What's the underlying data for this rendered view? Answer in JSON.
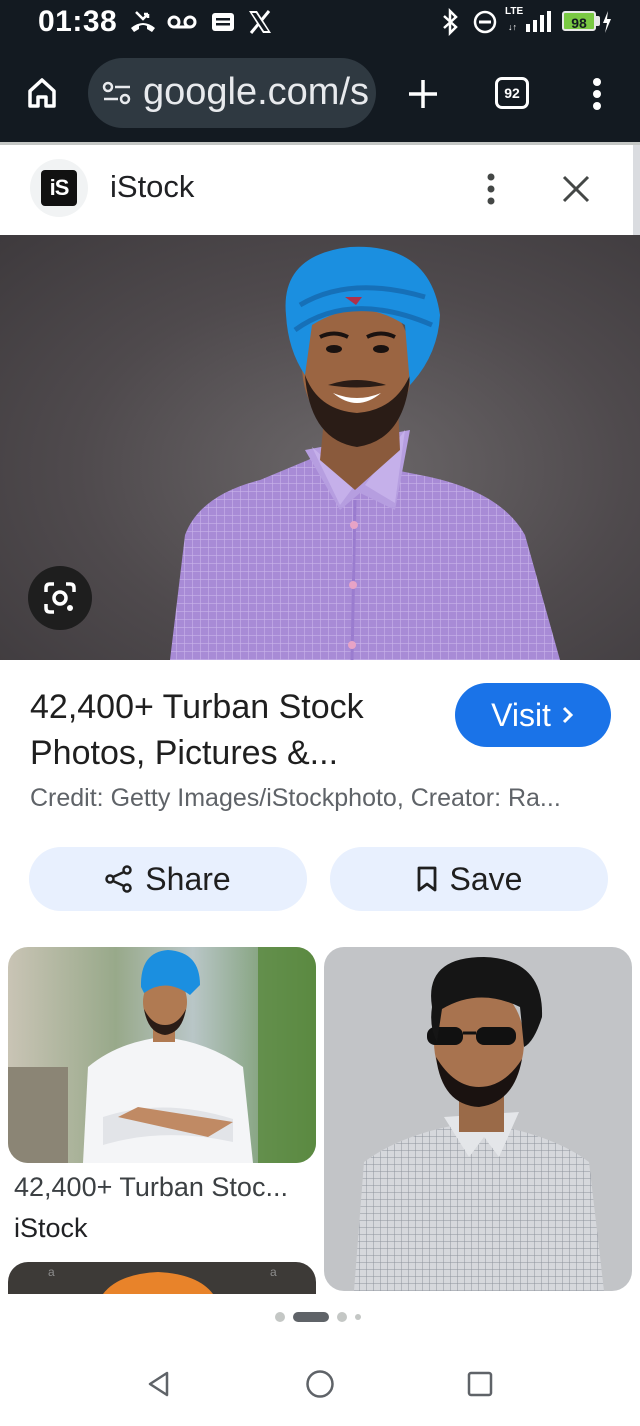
{
  "status_bar": {
    "time": "01:38",
    "network": "LTE",
    "battery": "98"
  },
  "browser": {
    "url": "google.com/s",
    "tab_count": "92"
  },
  "source": {
    "name": "iStock",
    "logo_text": "iS"
  },
  "result": {
    "title": "42,400+ Turban Stock Photos, Pictures &...",
    "visit_label": "Visit",
    "credit": "Credit: Getty Images/iStockphoto, Creator: Ra..."
  },
  "actions": {
    "share_label": "Share",
    "save_label": "Save"
  },
  "related": [
    {
      "caption": "42,400+ Turban Stoc...",
      "source": "iStock"
    }
  ],
  "colors": {
    "accent": "#1a73e8",
    "chip_bg": "#e8f0fe",
    "toolbar_bg": "#131a21",
    "turban_blue": "#1b8fe0"
  },
  "icons": [
    "home-icon",
    "site-settings-icon",
    "plus-icon",
    "tab-switcher-icon",
    "more-vert-icon",
    "close-icon",
    "google-lens-icon",
    "share-icon",
    "bookmark-icon",
    "back-nav-icon",
    "home-nav-icon",
    "recents-nav-icon"
  ]
}
